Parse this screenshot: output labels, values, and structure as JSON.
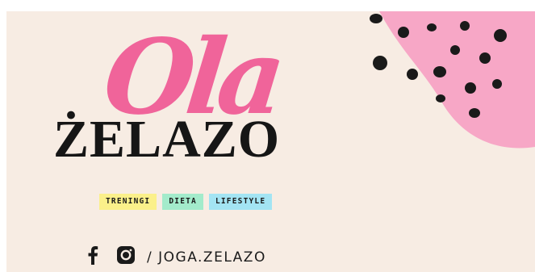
{
  "banner": {
    "first_name": "Ola",
    "surname": "ŻELAZO",
    "tags": [
      {
        "label": "TRENINGI",
        "color": "#fbf08a"
      },
      {
        "label": "DIETA",
        "color": "#a3ebcb"
      },
      {
        "label": "LIFESTYLE",
        "color": "#a3e4f3"
      }
    ],
    "social": {
      "icons": [
        "facebook-icon",
        "instagram-icon"
      ],
      "handle": "/ JOGA.ZELAZO"
    },
    "colors": {
      "background": "#f7ece3",
      "accent_pink": "#f7a7c6",
      "script_pink": "#f0649a",
      "text_dark": "#161616"
    }
  }
}
